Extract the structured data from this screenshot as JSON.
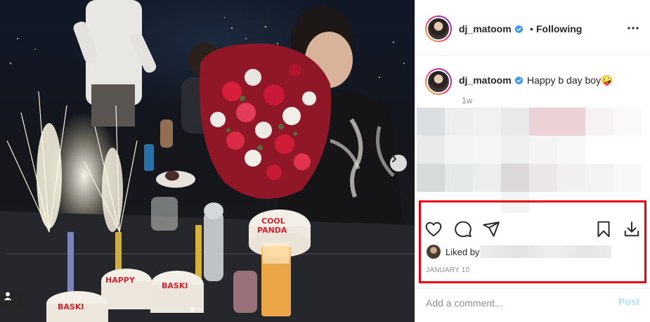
{
  "post": {
    "author": {
      "username": "dj_matoom",
      "verified": true
    },
    "header": {
      "follow_status": "Following",
      "separator": "•"
    },
    "caption": {
      "username": "dj_matoom",
      "text": "Happy b day boy🤪",
      "time": "1w"
    },
    "likes": {
      "label": "Liked by"
    },
    "date": "JANUARY 10",
    "comment": {
      "placeholder": "Add a comment...",
      "post_label": "Post"
    },
    "carousel": {
      "slide_count": 2,
      "active_slide": 1
    }
  },
  "icons": {
    "verified": "verified-badge-icon",
    "more": "more-options-icon",
    "like": "heart-icon",
    "comment": "comment-bubble-icon",
    "share": "paper-plane-icon",
    "save": "bookmark-icon",
    "download": "download-icon",
    "next": "chevron-right-icon",
    "user_tag": "person-icon"
  },
  "colors": {
    "verified": "#3897f0",
    "highlight": "#e60012",
    "post_disabled": "#b2dffc",
    "muted_text": "#8e8e8e"
  }
}
